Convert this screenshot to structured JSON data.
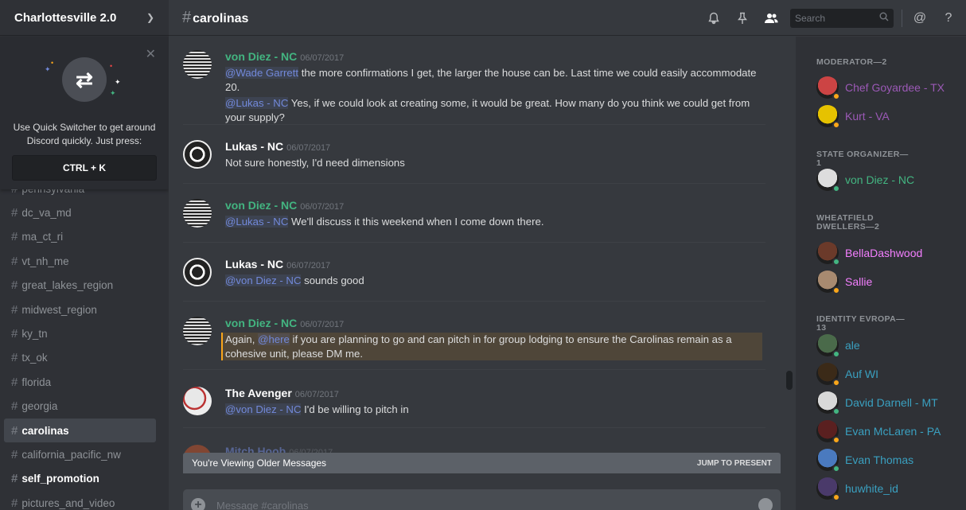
{
  "server": {
    "name": "Charlottesville 2.0"
  },
  "quick_switcher": {
    "text": "Use Quick Switcher to get around Discord quickly. Just press:",
    "shortcut": "CTRL + K"
  },
  "channels": [
    {
      "name": "pennsylvania",
      "state": "partial"
    },
    {
      "name": "dc_va_md",
      "state": "normal"
    },
    {
      "name": "ma_ct_ri",
      "state": "normal"
    },
    {
      "name": "vt_nh_me",
      "state": "normal"
    },
    {
      "name": "great_lakes_region",
      "state": "normal"
    },
    {
      "name": "midwest_region",
      "state": "normal"
    },
    {
      "name": "ky_tn",
      "state": "normal"
    },
    {
      "name": "tx_ok",
      "state": "normal"
    },
    {
      "name": "florida",
      "state": "normal"
    },
    {
      "name": "georgia",
      "state": "normal"
    },
    {
      "name": "carolinas",
      "state": "active"
    },
    {
      "name": "california_pacific_nw",
      "state": "normal"
    },
    {
      "name": "self_promotion",
      "state": "bright"
    },
    {
      "name": "pictures_and_video",
      "state": "partial"
    }
  ],
  "header": {
    "channel": "carolinas",
    "search_placeholder": "Search"
  },
  "messages": [
    {
      "author": "von Diez - NC",
      "author_color": "#43b581",
      "timestamp": "06/07/2017",
      "lines": [
        [
          {
            "t": "@Wade Garrett",
            "m": true
          },
          {
            "t": " the more confirmations I get, the larger the house can be. Last time we could easily accommodate 20."
          }
        ],
        [
          {
            "t": "@Lukas - NC",
            "m": true
          },
          {
            "t": " Yes, if we could look at creating some, it would be great. How many do you think we could get from your supply?"
          }
        ]
      ]
    },
    {
      "author": "Lukas - NC",
      "author_color": "#ffffff",
      "timestamp": "06/07/2017",
      "lines": [
        [
          {
            "t": "Not sure honestly, I'd need dimensions"
          }
        ]
      ]
    },
    {
      "author": "von Diez - NC",
      "author_color": "#43b581",
      "timestamp": "06/07/2017",
      "lines": [
        [
          {
            "t": "@Lukas - NC",
            "m": true
          },
          {
            "t": " We'll discuss it this weekend when I come down there."
          }
        ]
      ]
    },
    {
      "author": "Lukas - NC",
      "author_color": "#ffffff",
      "timestamp": "06/07/2017",
      "lines": [
        [
          {
            "t": "@von Diez - NC",
            "m": true
          },
          {
            "t": " sounds good"
          }
        ]
      ]
    },
    {
      "author": "von Diez - NC",
      "author_color": "#43b581",
      "timestamp": "06/07/2017",
      "highlighted": true,
      "lines": [
        [
          {
            "t": "Again, "
          },
          {
            "t": "@here",
            "m": true
          },
          {
            "t": "  if you are planning to go and can pitch in for group lodging to ensure the Carolinas remain as a cohesive unit, please DM me."
          }
        ]
      ]
    },
    {
      "author": "The Avenger",
      "author_color": "#ffffff",
      "timestamp": "06/07/2017",
      "lines": [
        [
          {
            "t": "@von Diez - NC",
            "m": true
          },
          {
            "t": " I'd be willing to pitch in"
          }
        ]
      ]
    },
    {
      "author": "Mitch Hoob",
      "author_color": "#7289da",
      "timestamp": "06/07/2017",
      "lines": []
    }
  ],
  "older_bar": {
    "text": "You're Viewing Older Messages",
    "jump": "JUMP TO PRESENT"
  },
  "composer": {
    "placeholder": "Message #carolinas"
  },
  "member_groups": [
    {
      "role": "MODERATOR—2",
      "members": [
        {
          "name": "Chef Goyardee - TX",
          "color": "#9b59b6",
          "status": "#faa61a"
        },
        {
          "name": "Kurt - VA",
          "color": "#9b59b6",
          "status": "#faa61a"
        }
      ]
    },
    {
      "role": "STATE ORGANIZER—1",
      "members": [
        {
          "name": "von Diez - NC",
          "color": "#43b581",
          "status": "#43b581"
        }
      ]
    },
    {
      "role": "WHEATFIELD DWELLERS—2",
      "members": [
        {
          "name": "BellaDashwood",
          "color": "#f47fff",
          "status": "#43b581"
        },
        {
          "name": "Sallie",
          "color": "#f47fff",
          "status": "#faa61a"
        }
      ]
    },
    {
      "role": "IDENTITY EVROPA—13",
      "members": [
        {
          "name": "ale",
          "color": "#3aa0c0",
          "status": "#43b581"
        },
        {
          "name": "Auf WI",
          "color": "#3aa0c0",
          "status": "#faa61a"
        },
        {
          "name": "David Darnell - MT",
          "color": "#3aa0c0",
          "status": "#43b581"
        },
        {
          "name": "Evan McLaren - PA",
          "color": "#3aa0c0",
          "status": "#faa61a"
        },
        {
          "name": "Evan Thomas",
          "color": "#3aa0c0",
          "status": "#43b581"
        },
        {
          "name": "huwhite_id",
          "color": "#3aa0c0",
          "status": "#faa61a"
        }
      ]
    }
  ]
}
